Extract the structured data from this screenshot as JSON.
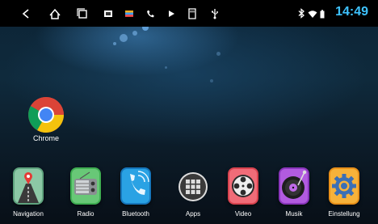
{
  "statusbar": {
    "clock": "14:49",
    "nav_icons": [
      "back-icon",
      "home-icon",
      "recents-icon",
      "screenshot-icon",
      "color-icon",
      "phone-icon",
      "media-icon",
      "sd-card-icon",
      "usb-icon"
    ],
    "system_icons": [
      "bluetooth-icon",
      "wifi-icon",
      "battery-icon"
    ]
  },
  "desktop": {
    "chrome_label": "Chrome"
  },
  "dock": {
    "apps": [
      {
        "label": "Navigation",
        "icon": "navigation-icon",
        "color": "#4c8f6a"
      },
      {
        "label": "Radio",
        "icon": "radio-icon",
        "color": "#46b45c"
      },
      {
        "label": "Bluetooth",
        "icon": "bluetooth-phone-icon",
        "color": "#1e84c9"
      },
      {
        "label": "Apps",
        "icon": "apps-grid-icon",
        "color": "#3a3a3a"
      },
      {
        "label": "Video",
        "icon": "video-icon",
        "color": "#e24b5b"
      },
      {
        "label": "Musik",
        "icon": "music-icon",
        "color": "#a04ad0"
      },
      {
        "label": "Einstellung",
        "icon": "settings-icon",
        "color": "#f0a020"
      }
    ]
  },
  "colors": {
    "clock": "#3ec3ff",
    "statusbar": "#000000"
  }
}
